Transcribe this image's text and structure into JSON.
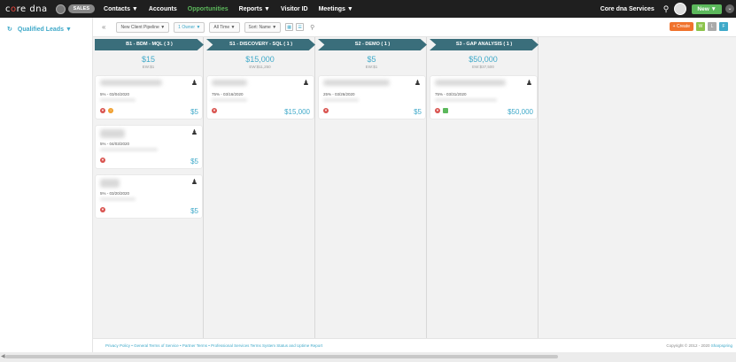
{
  "brand": {
    "logo_left": "c",
    "logo_o": "o",
    "logo_right": "re dna",
    "app_badge": "SALES"
  },
  "nav": {
    "items": [
      {
        "label": "Contacts ▼",
        "active": false
      },
      {
        "label": "Accounts",
        "active": false
      },
      {
        "label": "Opportunities",
        "active": true
      },
      {
        "label": "Reports ▼",
        "active": false
      },
      {
        "label": "Visitor ID",
        "active": false
      },
      {
        "label": "Meetings ▼",
        "active": false
      }
    ],
    "service": "Core dna Services",
    "new_label": "New ▼"
  },
  "left": {
    "title": "Qualified Leads ▼"
  },
  "toolbar": {
    "collapse": "«",
    "pipeline": "New Client Pipeline ▼",
    "owner": "1 Owner ▼",
    "time": "All Time ▼",
    "sort": "Sort: Name ▼",
    "create": "+ Create",
    "btn_w": "W",
    "btn_l": "L",
    "btn_f": "F"
  },
  "columns": [
    {
      "title": "B1 - BDM - MQL ( 3 )",
      "amount": "$15",
      "ew": "EW:$1",
      "cards": [
        {
          "prob": "5% - 03/04/2020",
          "amount": "$5",
          "icons": [
            "red",
            "orange"
          ]
        },
        {
          "prob": "5% - 04/03/2020",
          "amount": "$5",
          "icons": [
            "red"
          ]
        },
        {
          "prob": "5% - 03/20/2020",
          "amount": "$5",
          "icons": [
            "red"
          ]
        }
      ]
    },
    {
      "title": "S1 - DISCOVERY - SQL ( 1 )",
      "amount": "$15,000",
      "ew": "EW:$11,250",
      "cards": [
        {
          "prob": "75% - 03/16/2020",
          "amount": "$15,000",
          "icons": [
            "red"
          ]
        }
      ]
    },
    {
      "title": "S2 - DEMO ( 1 )",
      "amount": "$5",
      "ew": "EW:$1",
      "cards": [
        {
          "prob": "25% - 03/26/2020",
          "amount": "$5",
          "icons": [
            "red"
          ]
        }
      ]
    },
    {
      "title": "S3 - GAP ANALYSIS ( 1 )",
      "amount": "$50,000",
      "ew": "EW:$37,500",
      "cards": [
        {
          "prob": "75% - 03/31/2020",
          "amount": "$50,000",
          "icons": [
            "red",
            "doc"
          ]
        }
      ]
    }
  ],
  "footer": {
    "links": "Privacy Policy • General Terms of Service • Partner Terms • Professional Services Terms System Status and Uptime Report",
    "copyright": "Copyright © 2012 - 2020 ",
    "copyright_brand": "Sharpspring"
  },
  "colors": {
    "accent": "#3fa9c9",
    "stage": "#3a6e7b",
    "active_nav": "#5cb85c",
    "create": "#f0722d"
  }
}
